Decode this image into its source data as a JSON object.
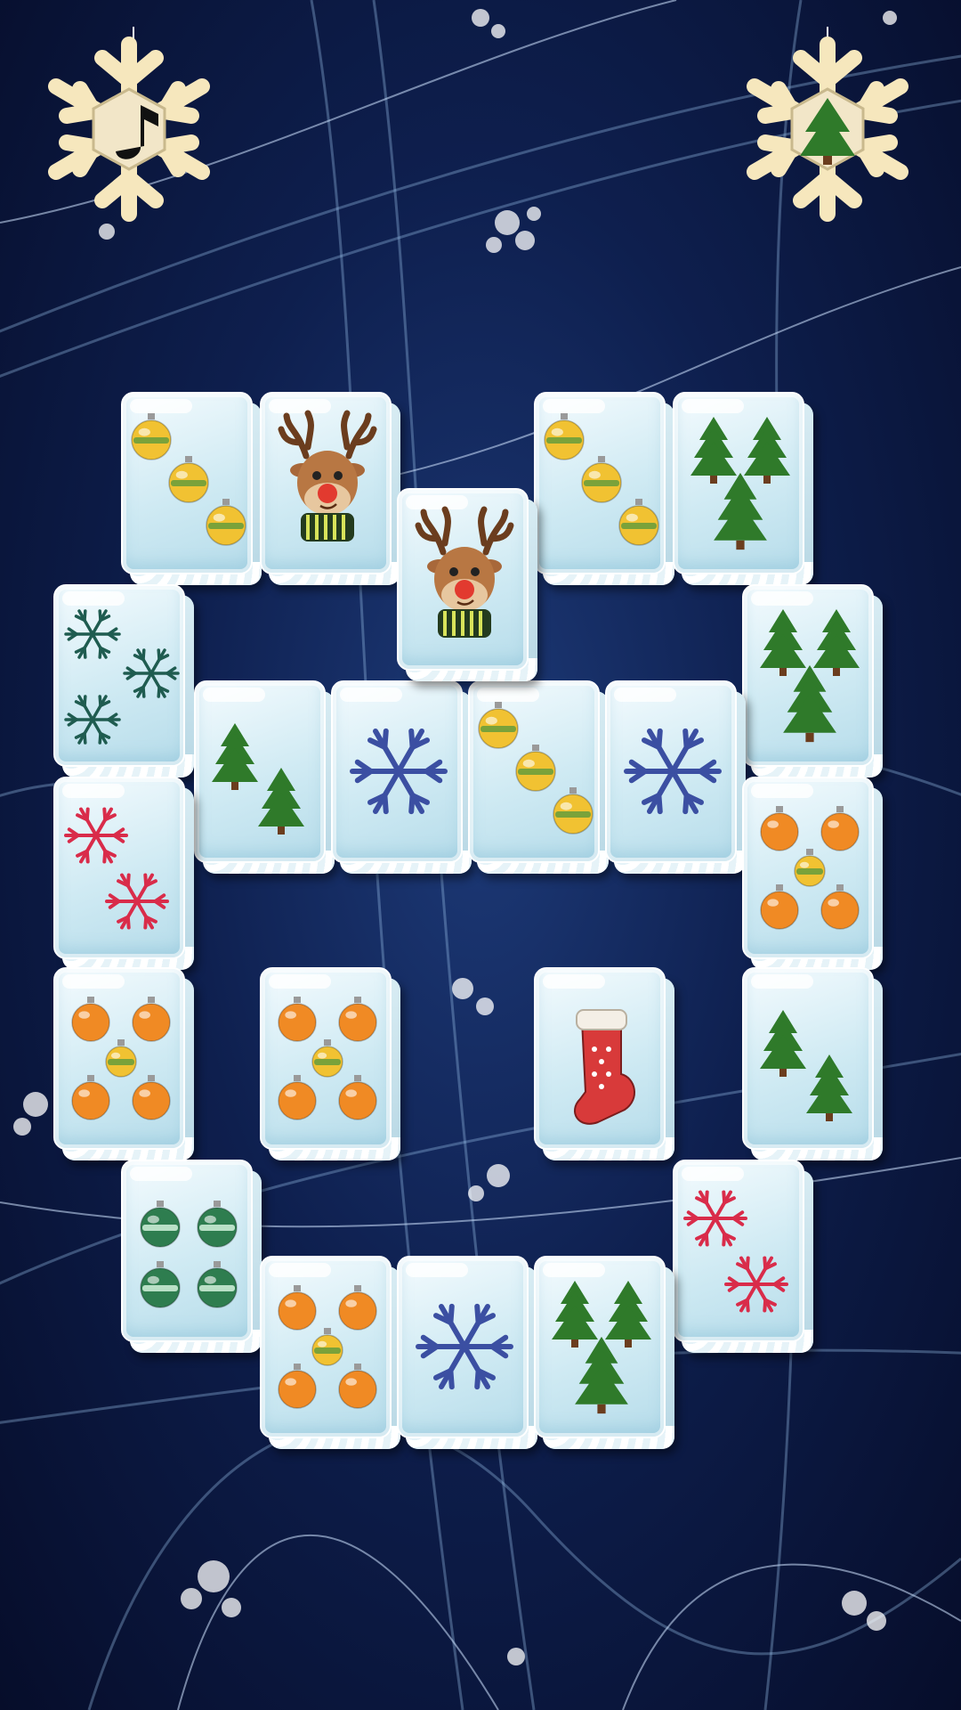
{
  "game": {
    "buttons": [
      {
        "name": "music-toggle-button",
        "icon": "music-note-icon"
      },
      {
        "name": "tree-menu-button",
        "icon": "christmas-tree-icon"
      }
    ],
    "colors": {
      "background": "#0e1f4e",
      "snowflake_button": "#f6e7bd",
      "tile_face": "#dff1f7",
      "ornament_gold": "#f1c232",
      "ornament_orange": "#f08a24",
      "ornament_green": "#2e7d4f",
      "snowflake_blue": "#3b4fa2",
      "snowflake_teal": "#1f5c50",
      "snowflake_red": "#d92c4a",
      "tree_green": "#2f7a2a"
    },
    "tiles": [
      {
        "symbol": "gold-ornaments-3",
        "layer": 0
      },
      {
        "symbol": "reindeer",
        "layer": 0
      },
      {
        "symbol": "reindeer",
        "layer": 1
      },
      {
        "symbol": "gold-ornaments-3",
        "layer": 0
      },
      {
        "symbol": "trees-3",
        "layer": 0
      },
      {
        "symbol": "teal-snowflakes-3",
        "layer": 0
      },
      {
        "symbol": "trees-3",
        "layer": 0
      },
      {
        "symbol": "trees-2",
        "layer": 0
      },
      {
        "symbol": "blue-snowflake-1",
        "layer": 0
      },
      {
        "symbol": "gold-ornaments-3",
        "layer": 0
      },
      {
        "symbol": "blue-snowflake-1",
        "layer": 0
      },
      {
        "symbol": "red-snowflakes-2",
        "layer": 0
      },
      {
        "symbol": "orange-ornaments-5",
        "layer": 0
      },
      {
        "symbol": "orange-ornaments-5",
        "layer": 0
      },
      {
        "symbol": "orange-ornaments-5",
        "layer": 0
      },
      {
        "symbol": "stocking",
        "layer": 0
      },
      {
        "symbol": "trees-2",
        "layer": 0
      },
      {
        "symbol": "green-ornaments-4",
        "layer": 0
      },
      {
        "symbol": "red-snowflakes-2",
        "layer": 0
      },
      {
        "symbol": "orange-ornaments-5",
        "layer": 0
      },
      {
        "symbol": "blue-snowflake-1",
        "layer": 0
      },
      {
        "symbol": "trees-3",
        "layer": 0
      }
    ]
  }
}
